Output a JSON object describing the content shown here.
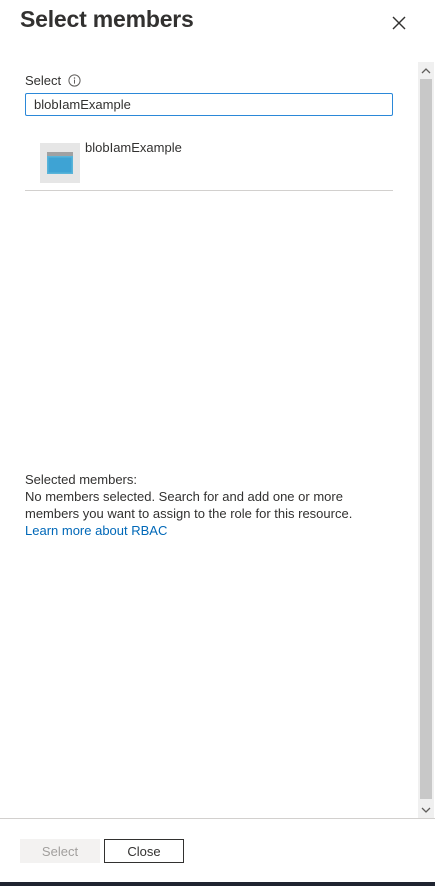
{
  "header": {
    "title": "Select members",
    "close_icon": "close-icon"
  },
  "search": {
    "label": "Select",
    "info_icon": "info-icon",
    "value": "blobIamExample"
  },
  "results": [
    {
      "name": "blobIamExample",
      "icon": "application-icon"
    }
  ],
  "selected": {
    "heading": "Selected members:",
    "empty_message": "No members selected. Search for and add one or more members you want to assign to the role for this resource.",
    "learn_more_link": "Learn more about RBAC"
  },
  "footer": {
    "select_label": "Select",
    "close_label": "Close"
  },
  "colors": {
    "accent": "#2b88d8",
    "link": "#0068b8",
    "disabled_text": "#a19f9d",
    "disabled_bg": "#f3f2f1"
  }
}
